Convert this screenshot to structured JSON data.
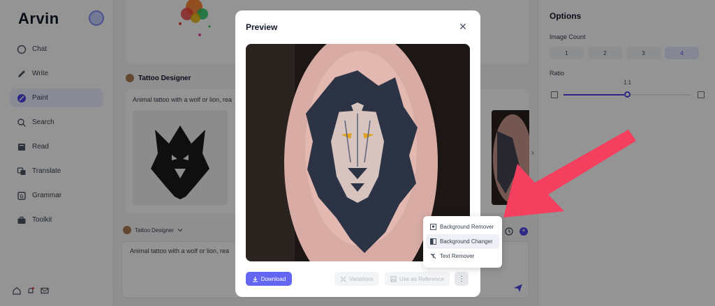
{
  "app": {
    "brand": "Arvin"
  },
  "sidebar": {
    "items": [
      {
        "label": "Chat",
        "icon": "chat-icon"
      },
      {
        "label": "Write",
        "icon": "pen-icon"
      },
      {
        "label": "Paint",
        "icon": "palette-icon",
        "active": true
      },
      {
        "label": "Search",
        "icon": "search-icon"
      },
      {
        "label": "Read",
        "icon": "book-icon"
      },
      {
        "label": "Translate",
        "icon": "translate-icon"
      },
      {
        "label": "Grammar",
        "icon": "grammar-icon"
      },
      {
        "label": "Toolkit",
        "icon": "toolbox-icon"
      }
    ]
  },
  "chat": {
    "designer_name": "Tattoo Designer",
    "prompt_preview": "Animal tattoo with a wolf or lion, rea",
    "input_value": "Animal tattoo with a wolf or lion, rea",
    "selector_label": "Tattoo Designer"
  },
  "options": {
    "title": "Options",
    "image_count_label": "Image Count",
    "counts": [
      "1",
      "2",
      "3",
      "4"
    ],
    "selected_count": "4",
    "ratio_label": "Ratio",
    "ratio_value": "1:1",
    "ratio_slider_fraction": 0.5
  },
  "modal": {
    "title": "Preview",
    "download_label": "Download",
    "variations_label": "Variations",
    "reference_label": "Use as Reference"
  },
  "dropdown": {
    "items": [
      {
        "label": "Background Remover",
        "icon": "background-remover-icon"
      },
      {
        "label": "Background Changer",
        "icon": "background-changer-icon",
        "hover": true
      },
      {
        "label": "Text Remover",
        "icon": "text-remover-icon"
      }
    ]
  },
  "colors": {
    "accent": "#6366f1",
    "annotation_arrow": "#f43f5e"
  }
}
